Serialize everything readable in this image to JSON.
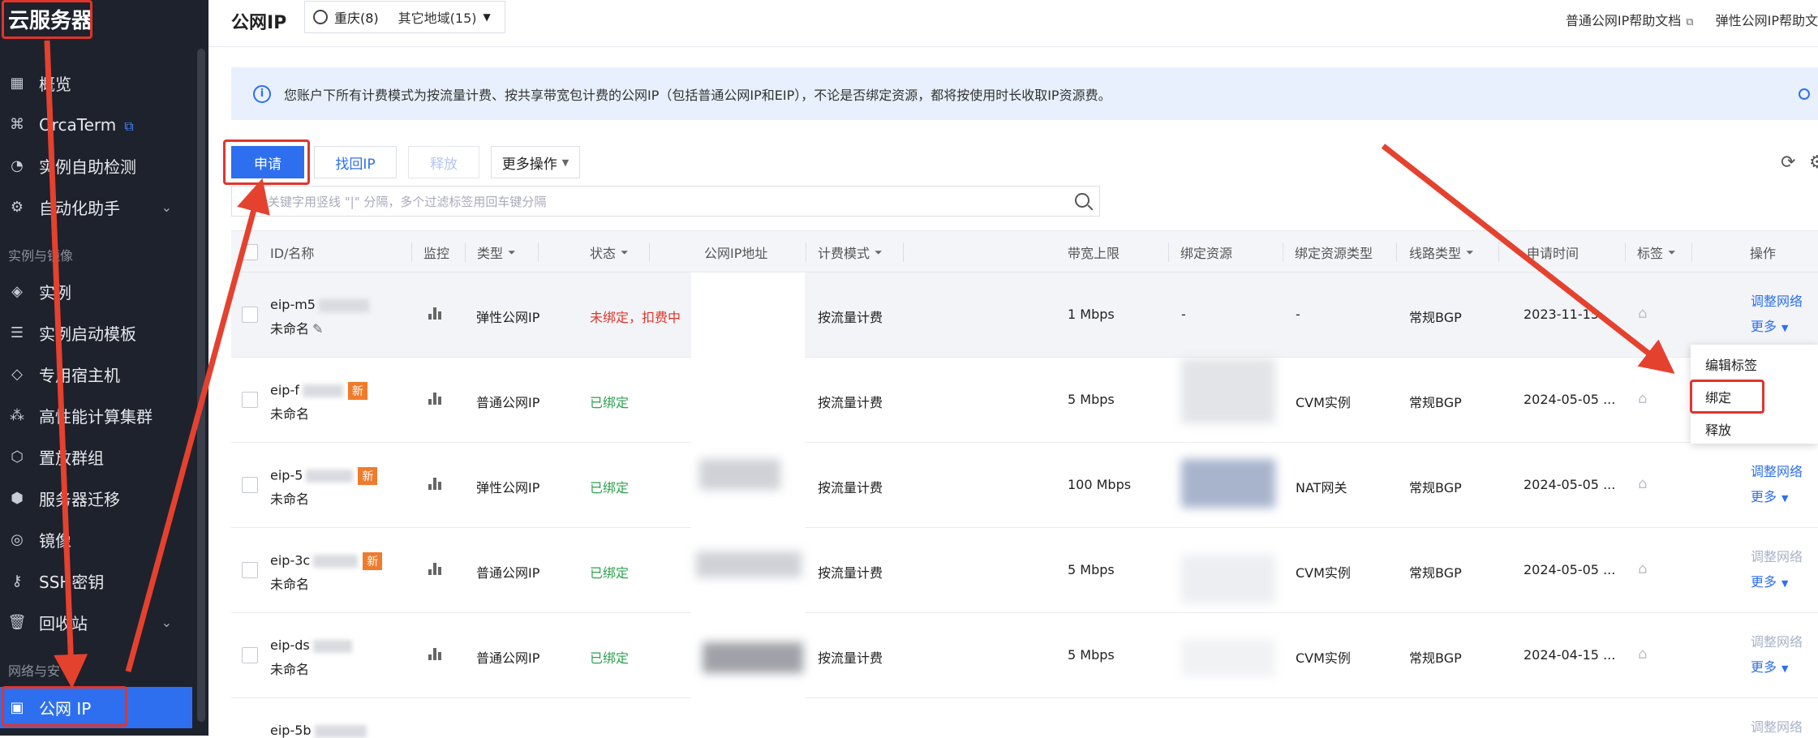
{
  "sidebar": {
    "title": "云服务器",
    "items": [
      {
        "label": "概览",
        "icon": "grid-icon"
      },
      {
        "label": "OrcaTerm",
        "icon": "terminal-icon",
        "external": true
      },
      {
        "label": "实例自助检测",
        "icon": "check-icon"
      },
      {
        "label": "自动化助手",
        "icon": "robot-icon",
        "expandable": true
      },
      {
        "label": "实例",
        "icon": "cube-icon"
      },
      {
        "label": "实例启动模板",
        "icon": "template-icon"
      },
      {
        "label": "专用宿主机",
        "icon": "host-icon"
      },
      {
        "label": "高性能计算集群",
        "icon": "cluster-icon"
      },
      {
        "label": "置放群组",
        "icon": "placement-icon"
      },
      {
        "label": "服务器迁移",
        "icon": "migrate-icon"
      },
      {
        "label": "镜像",
        "icon": "image-icon"
      },
      {
        "label": "SSH密钥",
        "icon": "key-icon"
      },
      {
        "label": "回收站",
        "icon": "trash-icon",
        "expandable": true
      },
      {
        "label": "公网 IP",
        "icon": "ip-icon",
        "active": true
      }
    ],
    "groups": [
      "实例与镜像",
      "网络与安"
    ]
  },
  "header": {
    "title": "公网IP",
    "region": "重庆(8)",
    "other_regions": "其它地域(15)",
    "doc_links": [
      "普通公网IP帮助文档",
      "弹性公网IP帮助文"
    ]
  },
  "notice": "您账户下所有计费模式为按流量计费、按共享带宽包计费的公网IP（包括普通公网IP和EIP），不论是否绑定资源，都将按使用时长收取IP资源费。",
  "toolbar": {
    "apply": "申请",
    "retrieve": "找回IP",
    "release": "释放",
    "more": "更多操作",
    "search_placeholder": "多个关键字用竖线 \"|\" 分隔，多个过滤标签用回车键分隔"
  },
  "table": {
    "headers": [
      "ID/名称",
      "监控",
      "类型",
      "状态",
      "公网IP地址",
      "计费模式",
      "带宽上限",
      "绑定资源",
      "绑定资源类型",
      "线路类型",
      "申请时间",
      "标签",
      "操作"
    ],
    "rows": [
      {
        "id": "eip-m5",
        "name": "未命名",
        "is_new": false,
        "type": "弹性公网IP",
        "status": "未绑定，扣费中",
        "status_color": "#e0352b",
        "billing": "按流量计费",
        "bandwidth": "1 Mbps",
        "resource": "-",
        "resource_type": "-",
        "line": "常规BGP",
        "time": "2023-11-15",
        "op1": "调整网络",
        "op2": "更多"
      },
      {
        "id": "eip-f",
        "name": "未命名",
        "is_new": true,
        "type": "普通公网IP",
        "status": "已绑定",
        "status_color": "#2ba24c",
        "billing": "按流量计费",
        "bandwidth": "5 Mbps",
        "resource": "",
        "resource_type": "CVM实例",
        "line": "常规BGP",
        "time": "2024-05-05 ...",
        "op1": "",
        "op2": ""
      },
      {
        "id": "eip-5",
        "name": "未命名",
        "is_new": true,
        "type": "弹性公网IP",
        "status": "已绑定",
        "status_color": "#2ba24c",
        "billing": "按流量计费",
        "bandwidth": "100 Mbps",
        "resource": "",
        "resource_type": "NAT网关",
        "line": "常规BGP",
        "time": "2024-05-05 ...",
        "op1": "调整网络",
        "op2": "更多"
      },
      {
        "id": "eip-3c",
        "name": "未命名",
        "is_new": true,
        "type": "普通公网IP",
        "status": "已绑定",
        "status_color": "#2ba24c",
        "billing": "按流量计费",
        "bandwidth": "5 Mbps",
        "resource": "",
        "resource_type": "CVM实例",
        "line": "常规BGP",
        "time": "2024-05-05 ...",
        "op1": "调整网络",
        "op2": "更多"
      },
      {
        "id": "eip-ds",
        "name": "未命名",
        "is_new": false,
        "type": "普通公网IP",
        "status": "已绑定",
        "status_color": "#2ba24c",
        "billing": "按流量计费",
        "bandwidth": "5 Mbps",
        "resource": "",
        "resource_type": "CVM实例",
        "line": "常规BGP",
        "time": "2024-04-15 ...",
        "op1": "调整网络",
        "op2": "更多"
      },
      {
        "id": "eip-5b",
        "name": "",
        "is_new": false,
        "type": "",
        "status": "",
        "status_color": "#2ba24c",
        "billing": "",
        "bandwidth": "",
        "resource": "",
        "resource_type": "",
        "line": "",
        "time": "",
        "op1": "调整网络",
        "op2": ""
      }
    ]
  },
  "dropdown": {
    "items": [
      "编辑标签",
      "绑定",
      "释放"
    ],
    "highlighted": "绑定"
  },
  "colors": {
    "primary": "#2e6ff0",
    "sidebar_bg": "#1e222c",
    "annotation": "#e0352b",
    "notice_bg": "#e8f0fd"
  }
}
